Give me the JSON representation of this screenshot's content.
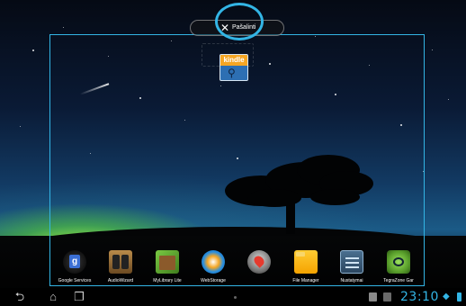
{
  "toolbar": {
    "remove_label": "Pašalinti",
    "remove_icon": "close-icon"
  },
  "dragged_app": {
    "label": "kindle",
    "icon": "kindle-app-icon"
  },
  "dock": {
    "apps": [
      {
        "label": "Google Services",
        "icon": "google-services-icon"
      },
      {
        "label": "AudioWizard",
        "icon": "audiowizard-icon"
      },
      {
        "label": "MyLibrary Lite",
        "icon": "mylibrary-icon"
      },
      {
        "label": "WebStorage",
        "icon": "webstorage-icon"
      },
      {
        "label": "",
        "icon": "maps-icon"
      },
      {
        "label": "File Manager",
        "icon": "file-manager-icon"
      },
      {
        "label": "Nustatymai",
        "icon": "settings-icon"
      },
      {
        "label": "TegraZone Gar",
        "icon": "tegrazone-icon"
      }
    ]
  },
  "navbar": {
    "back_icon": "back-icon",
    "home_icon": "home-icon",
    "recents_icon": "recent-apps-icon"
  },
  "status_bar": {
    "time": "23:10",
    "accent_color": "#33b5e5"
  }
}
